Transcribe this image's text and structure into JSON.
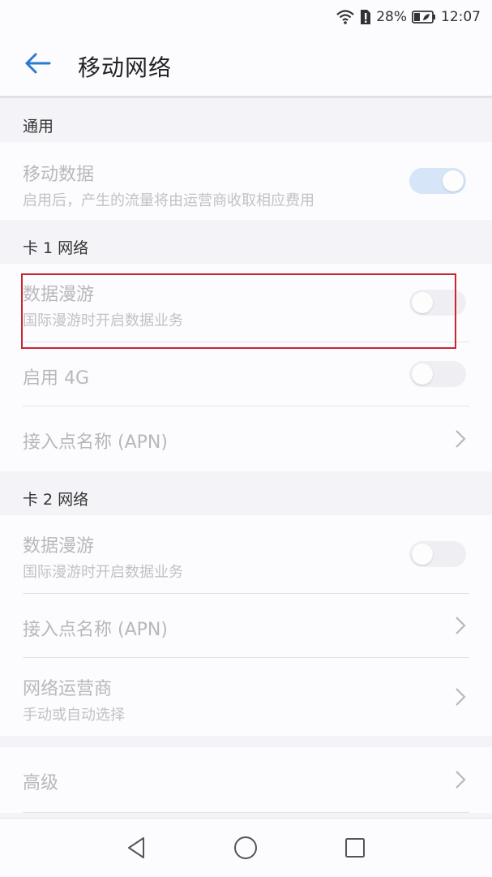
{
  "status": {
    "battery_percent": "28%",
    "time": "12:07"
  },
  "header": {
    "title": "移动网络"
  },
  "sections": {
    "general": {
      "title": "通用",
      "mobile_data": {
        "title": "移动数据",
        "subtitle": "启用后，产生的流量将由运营商收取相应费用",
        "enabled": true
      }
    },
    "sim1": {
      "title": "卡 1 网络",
      "data_roaming": {
        "title": "数据漫游",
        "subtitle": "国际漫游时开启数据业务",
        "enabled": false
      },
      "enable_4g": {
        "title": "启用 4G",
        "enabled": false
      },
      "apn": {
        "title": "接入点名称 (APN)"
      }
    },
    "sim2": {
      "title": "卡 2 网络",
      "data_roaming": {
        "title": "数据漫游",
        "subtitle": "国际漫游时开启数据业务",
        "enabled": false
      },
      "apn": {
        "title": "接入点名称 (APN)"
      },
      "operator": {
        "title": "网络运营商",
        "subtitle": "手动或自动选择"
      }
    },
    "advanced": {
      "title": "高级"
    }
  },
  "colors": {
    "accent": "#2a7bd0",
    "highlight_border": "#c8262e"
  },
  "icons": [
    "wifi-icon",
    "sim-alert-icon",
    "battery-icon",
    "back-arrow-icon",
    "chevron-right-icon",
    "nav-back-icon",
    "nav-home-icon",
    "nav-recents-icon"
  ]
}
